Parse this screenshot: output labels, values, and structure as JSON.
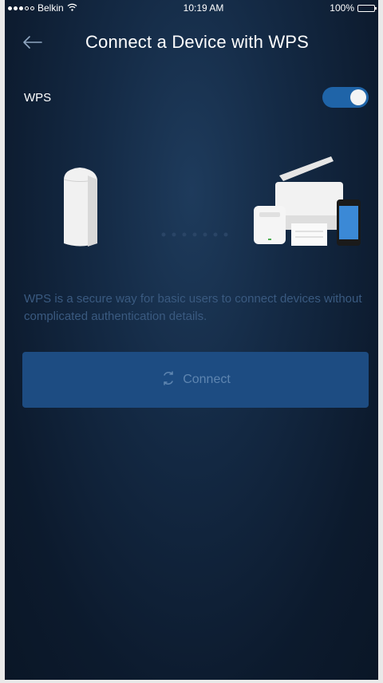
{
  "status_bar": {
    "carrier": "Belkin",
    "time": "10:19 AM",
    "battery": "100%",
    "signal_dots_filled": 3,
    "signal_dots_total": 5
  },
  "header": {
    "title": "Connect a Device with WPS",
    "back_icon": "back-arrow-icon"
  },
  "wps": {
    "label": "WPS",
    "toggle_on": true
  },
  "illustration": {
    "left_device_icon": "router-node-icon",
    "right_devices_icon": "printer-extender-phone-icon",
    "connection_icon": "dotted-connection-icon"
  },
  "description": "WPS is a secure way for basic users to connect devices without complicated authentication details.",
  "connect_button": {
    "label": "Connect",
    "icon": "wps-icon"
  },
  "colors": {
    "background": "#132842",
    "accent": "#1f64a8",
    "button": "#1d4c82",
    "muted_text": "#3a5a80"
  }
}
